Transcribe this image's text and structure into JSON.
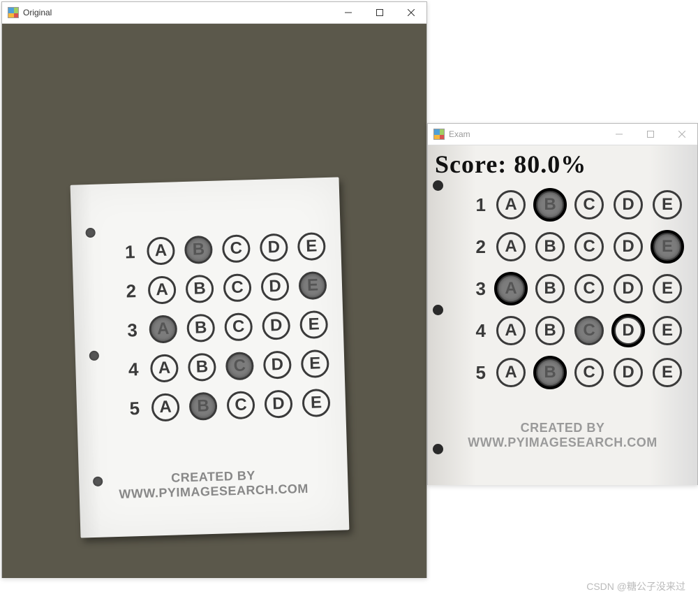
{
  "windows": {
    "original": {
      "title": "Original",
      "credit": "CREATED BY WWW.PYIMAGESEARCH.COM",
      "options": [
        "A",
        "B",
        "C",
        "D",
        "E"
      ],
      "rows": [
        {
          "n": "1",
          "filled": [
            "B"
          ]
        },
        {
          "n": "2",
          "filled": [
            "E"
          ]
        },
        {
          "n": "3",
          "filled": [
            "A"
          ]
        },
        {
          "n": "4",
          "filled": [
            "C"
          ]
        },
        {
          "n": "5",
          "filled": [
            "B"
          ]
        }
      ]
    },
    "exam": {
      "title": "Exam",
      "score": "Score: 80.0%",
      "credit": "CREATED BY WWW.PYIMAGESEARCH.COM",
      "options": [
        "A",
        "B",
        "C",
        "D",
        "E"
      ],
      "rows": [
        {
          "n": "1",
          "filled": [
            "B"
          ],
          "highlighted": [
            "B"
          ]
        },
        {
          "n": "2",
          "filled": [
            "E"
          ],
          "highlighted": [
            "E"
          ]
        },
        {
          "n": "3",
          "filled": [
            "A"
          ],
          "highlighted": [
            "A"
          ]
        },
        {
          "n": "4",
          "filled": [
            "C"
          ],
          "highlighted": [
            "D"
          ]
        },
        {
          "n": "5",
          "filled": [
            "B"
          ],
          "highlighted": [
            "B"
          ]
        }
      ]
    }
  },
  "watermark": "CSDN @糖公子没来过"
}
